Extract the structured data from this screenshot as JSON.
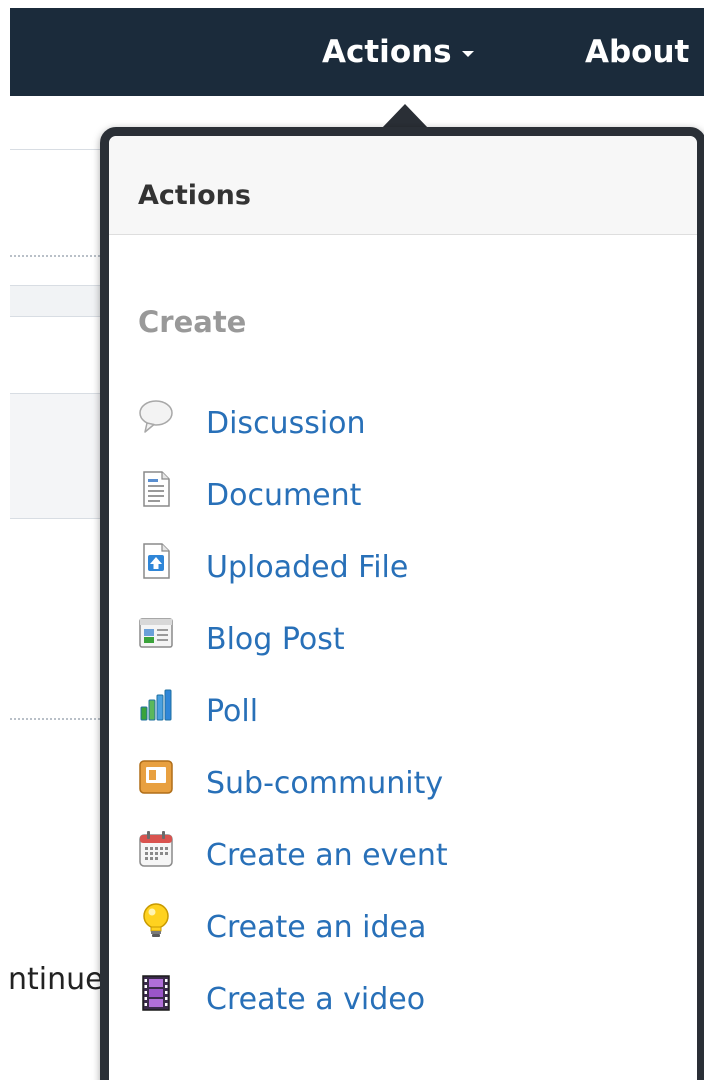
{
  "navbar": {
    "actions_label": "Actions",
    "about_label": "About"
  },
  "background": {
    "partial_text": "ntinue"
  },
  "popover": {
    "title": "Actions",
    "section_label": "Create",
    "items": [
      {
        "label": "Discussion",
        "icon": "speech-bubble-icon"
      },
      {
        "label": "Document",
        "icon": "document-icon"
      },
      {
        "label": "Uploaded File",
        "icon": "upload-file-icon"
      },
      {
        "label": "Blog Post",
        "icon": "blog-post-icon"
      },
      {
        "label": "Poll",
        "icon": "poll-chart-icon"
      },
      {
        "label": "Sub-community",
        "icon": "sub-community-icon"
      },
      {
        "label": "Create an event",
        "icon": "calendar-icon"
      },
      {
        "label": "Create an idea",
        "icon": "lightbulb-icon"
      },
      {
        "label": "Create a video",
        "icon": "film-strip-icon"
      }
    ]
  },
  "colors": {
    "navbar_bg": "#1b2b3b",
    "link": "#2870b8",
    "section_label": "#999999",
    "popover_border": "#2a2f36"
  }
}
